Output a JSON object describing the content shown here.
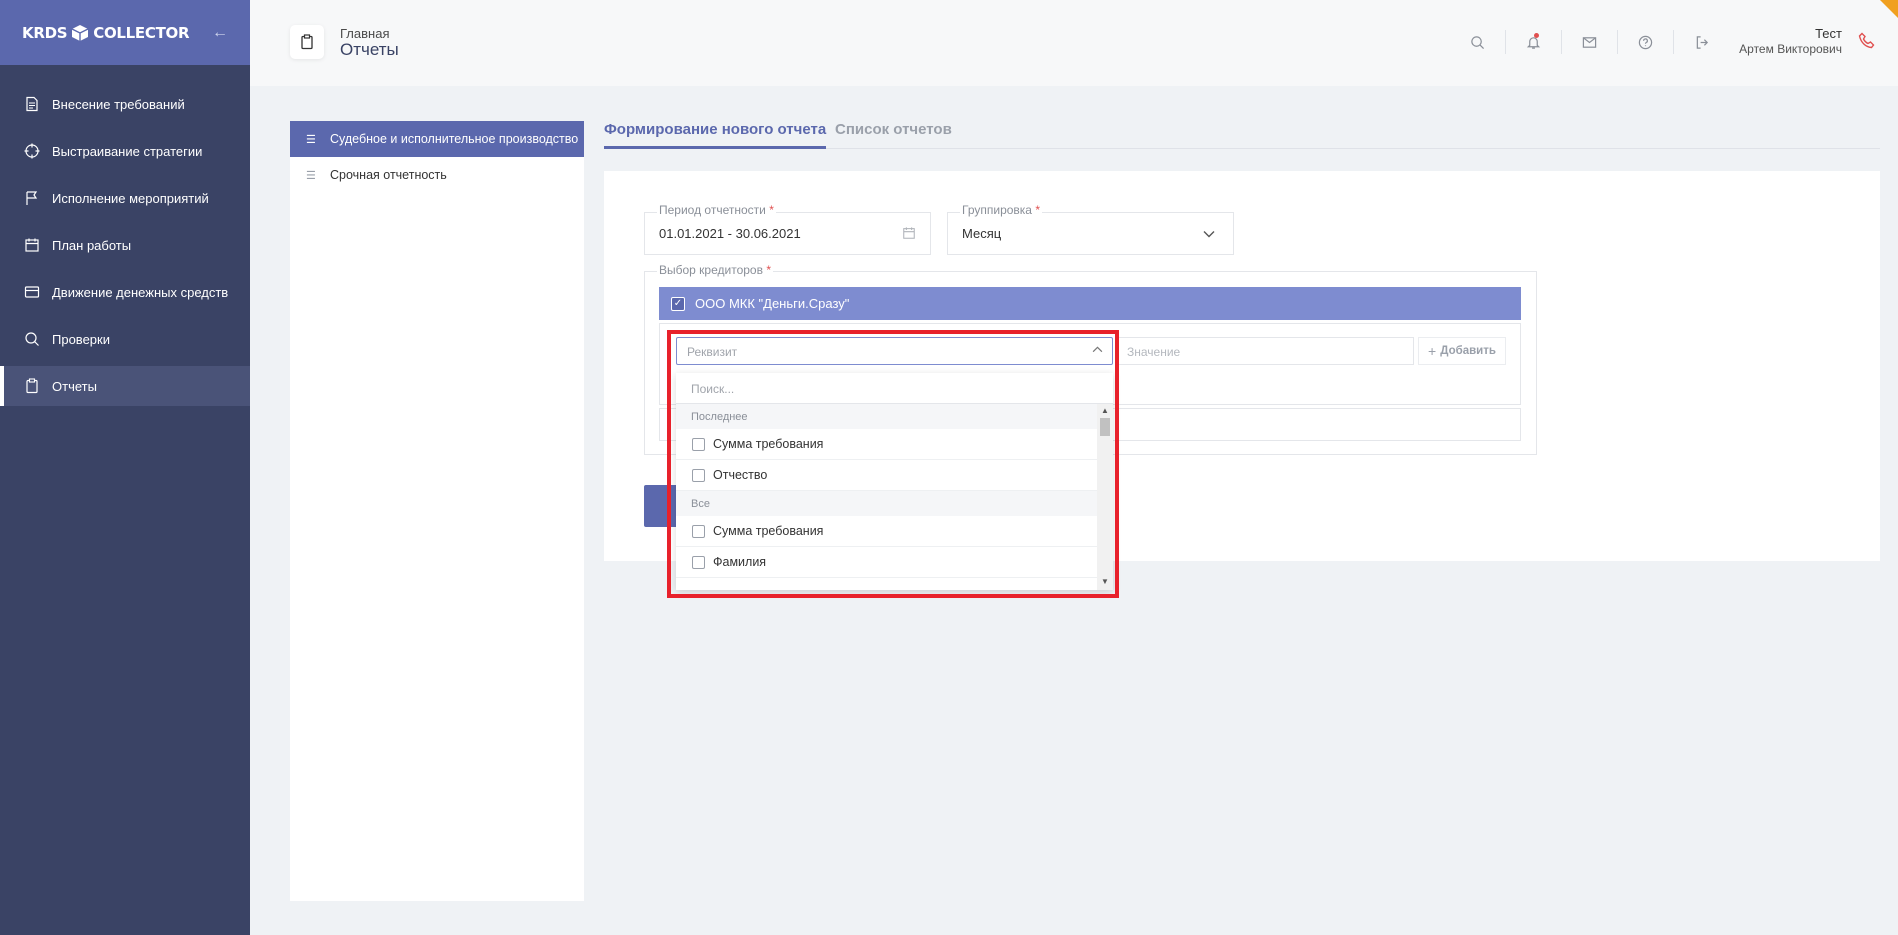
{
  "app": {
    "logo_text_left": "KRDS",
    "logo_text_right": "COLLECTOR"
  },
  "sidebar": {
    "items": [
      {
        "label": "Внесение требований",
        "icon": "document-icon"
      },
      {
        "label": "Выстраивание стратегии",
        "icon": "crosshair-icon"
      },
      {
        "label": "Исполнение мероприятий",
        "icon": "flag-icon"
      },
      {
        "label": "План работы",
        "icon": "calendar-icon"
      },
      {
        "label": "Движение денежных средств",
        "icon": "card-icon"
      },
      {
        "label": "Проверки",
        "icon": "search-icon"
      },
      {
        "label": "Отчеты",
        "icon": "clipboard-icon",
        "active": true
      }
    ]
  },
  "header": {
    "breadcrumb": "Главная",
    "title": "Отчеты",
    "user": {
      "name": "Тест",
      "sub": "Артем Викторович"
    }
  },
  "left_panel": {
    "items": [
      {
        "label": "Судебное и исполнительное производство",
        "active": true
      },
      {
        "label": "Срочная отчетность",
        "active": false
      }
    ]
  },
  "tabs": [
    {
      "label": "Формирование нового отчета",
      "active": true
    },
    {
      "label": "Список отчетов",
      "active": false
    }
  ],
  "form": {
    "period": {
      "label": "Период отчетности",
      "value": "01.01.2021 - 30.06.2021"
    },
    "grouping": {
      "label": "Группировка",
      "value": "Месяц"
    },
    "creditors": {
      "label": "Выбор кредиторов",
      "selected": "ООО МКК \"Деньги.Сразу\""
    },
    "required_mark": "*",
    "rekvizit": {
      "placeholder": "Реквизит"
    },
    "value": {
      "placeholder": "Значение"
    },
    "add_label": "Добавить"
  },
  "dropdown": {
    "search_placeholder": "Поиск...",
    "groups": [
      {
        "title": "Последнее",
        "items": [
          "Сумма требования",
          "Отчество"
        ]
      },
      {
        "title": "Все",
        "items": [
          "Сумма требования",
          "Фамилия"
        ]
      }
    ]
  },
  "colors": {
    "primary": "#5b68ad",
    "sidebar": "#3a4365",
    "highlight": "#e8212b"
  }
}
